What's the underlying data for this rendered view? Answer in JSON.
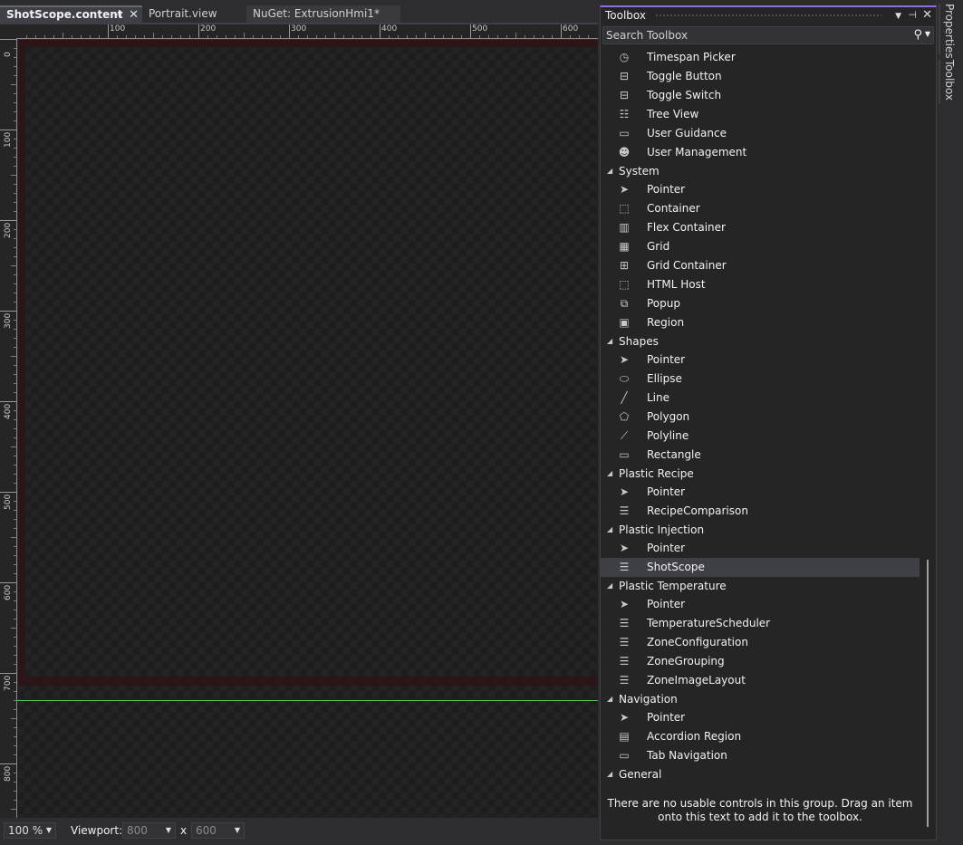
{
  "tabs": [
    {
      "label": "ShotScope.content",
      "active": true,
      "pin_icon": "pin-icon",
      "close_icon": "close-icon"
    },
    {
      "label": "Portrait.view",
      "active": false
    },
    {
      "label": "NuGet: ExtrusionHmi1*",
      "active": false
    }
  ],
  "ruler": {
    "top": [
      "100",
      "200",
      "300",
      "400",
      "500",
      "600"
    ],
    "left": [
      "0",
      "100",
      "200",
      "300",
      "400",
      "500",
      "600",
      "700",
      "800"
    ]
  },
  "statusbar": {
    "zoom": "100 %",
    "viewport_label": "Viewport:",
    "width": "800",
    "separator": "x",
    "height": "600"
  },
  "toolbox": {
    "title": "Toolbox",
    "search_placeholder": "Search Toolbox",
    "accent_color": "#8c6fd8",
    "groups": [
      {
        "type": "item",
        "label": "Timespan Picker",
        "icon": "timespan-icon"
      },
      {
        "type": "item",
        "label": "Toggle Button",
        "icon": "toggle-button-icon"
      },
      {
        "type": "item",
        "label": "Toggle Switch",
        "icon": "toggle-switch-icon"
      },
      {
        "type": "item",
        "label": "Tree View",
        "icon": "tree-view-icon"
      },
      {
        "type": "item",
        "label": "User Guidance",
        "icon": "folder-icon"
      },
      {
        "type": "item",
        "label": "User Management",
        "icon": "users-icon"
      },
      {
        "type": "group",
        "label": "System"
      },
      {
        "type": "item",
        "label": "Pointer",
        "icon": "pointer-icon"
      },
      {
        "type": "item",
        "label": "Container",
        "icon": "container-icon"
      },
      {
        "type": "item",
        "label": "Flex Container",
        "icon": "flex-container-icon"
      },
      {
        "type": "item",
        "label": "Grid",
        "icon": "grid-icon"
      },
      {
        "type": "item",
        "label": "Grid Container",
        "icon": "grid-container-icon"
      },
      {
        "type": "item",
        "label": "HTML Host",
        "icon": "html-host-icon"
      },
      {
        "type": "item",
        "label": "Popup",
        "icon": "popup-icon"
      },
      {
        "type": "item",
        "label": "Region",
        "icon": "region-icon"
      },
      {
        "type": "group",
        "label": "Shapes"
      },
      {
        "type": "item",
        "label": "Pointer",
        "icon": "pointer-icon"
      },
      {
        "type": "item",
        "label": "Ellipse",
        "icon": "ellipse-icon"
      },
      {
        "type": "item",
        "label": "Line",
        "icon": "line-icon"
      },
      {
        "type": "item",
        "label": "Polygon",
        "icon": "polygon-icon"
      },
      {
        "type": "item",
        "label": "Polyline",
        "icon": "polyline-icon"
      },
      {
        "type": "item",
        "label": "Rectangle",
        "icon": "rectangle-icon"
      },
      {
        "type": "group",
        "label": "Plastic Recipe"
      },
      {
        "type": "item",
        "label": "Pointer",
        "icon": "pointer-icon"
      },
      {
        "type": "item",
        "label": "RecipeComparison",
        "icon": "component-icon"
      },
      {
        "type": "group",
        "label": "Plastic Injection"
      },
      {
        "type": "item",
        "label": "Pointer",
        "icon": "pointer-icon"
      },
      {
        "type": "item",
        "label": "ShotScope",
        "icon": "component-icon",
        "selected": true
      },
      {
        "type": "group",
        "label": "Plastic Temperature"
      },
      {
        "type": "item",
        "label": "Pointer",
        "icon": "pointer-icon"
      },
      {
        "type": "item",
        "label": "TemperatureScheduler",
        "icon": "component-icon"
      },
      {
        "type": "item",
        "label": "ZoneConfiguration",
        "icon": "component-icon"
      },
      {
        "type": "item",
        "label": "ZoneGrouping",
        "icon": "component-icon"
      },
      {
        "type": "item",
        "label": "ZoneImageLayout",
        "icon": "component-icon"
      },
      {
        "type": "group",
        "label": "Navigation"
      },
      {
        "type": "item",
        "label": "Pointer",
        "icon": "pointer-icon"
      },
      {
        "type": "item",
        "label": "Accordion Region",
        "icon": "accordion-icon"
      },
      {
        "type": "item",
        "label": "Tab Navigation",
        "icon": "folder-icon"
      },
      {
        "type": "group",
        "label": "General"
      }
    ],
    "empty_message": "There are no usable controls in this group. Drag an item onto this text to add it to the toolbox."
  },
  "rail": {
    "properties": "Properties",
    "toolbox": "Toolbox"
  },
  "colors": {
    "guide_line": "#4fc152",
    "selection": "#3f3f46",
    "background": "#1e1e1e"
  }
}
